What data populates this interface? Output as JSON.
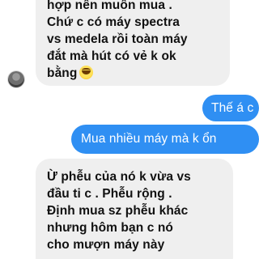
{
  "messages": [
    {
      "direction": "incoming",
      "lines": [
        "hợp nên muốn mua .",
        "Chứ c có máy  spectra",
        "vs medela rồi toàn máy",
        "đắt mà hút có vẻ k ok",
        "bằng"
      ],
      "emoji": "laughing-with-tears-emoji"
    },
    {
      "direction": "outgoing",
      "lines": [
        "Thế á c"
      ]
    },
    {
      "direction": "outgoing",
      "lines": [
        "Mua nhiều máy mà k ổn"
      ]
    },
    {
      "direction": "incoming",
      "lines": [
        "Ừ phễu của nó k vừa vs",
        "đầu ti c . Phễu rộng .",
        "Định mua sz phễu khác",
        "nhưng hôm bạn c nó",
        "cho mượn máy này"
      ]
    }
  ],
  "colors": {
    "incoming_bubble": "#efefef",
    "outgoing_bubble": "#2f8ff3",
    "incoming_text": "#111111",
    "outgoing_text": "#ffffff"
  }
}
